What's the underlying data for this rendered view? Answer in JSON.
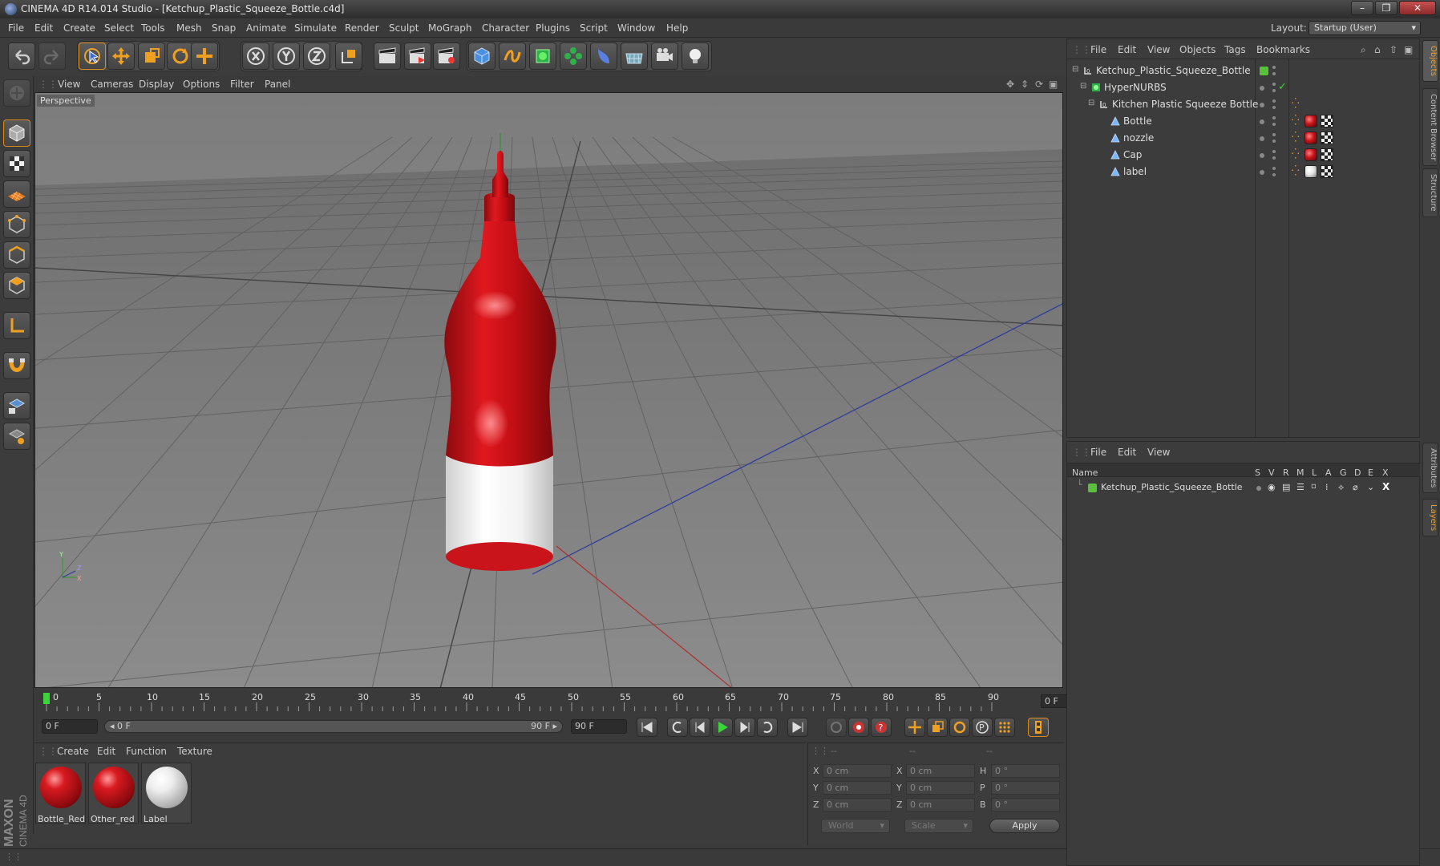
{
  "window": {
    "title": "CINEMA 4D R14.014 Studio - [Ketchup_Plastic_Squeeze_Bottle.c4d]",
    "controls": [
      "–",
      "❐",
      "✕"
    ]
  },
  "menu": [
    "File",
    "Edit",
    "Create",
    "Select",
    "Tools",
    "Mesh",
    "Snap",
    "Animate",
    "Simulate",
    "Render",
    "Sculpt",
    "MoGraph",
    "Character",
    "Plugins",
    "Script",
    "Window",
    "Help"
  ],
  "layout": {
    "label": "Layout:",
    "value": "Startup (User)"
  },
  "viewport": {
    "menu": [
      "View",
      "Cameras",
      "Display",
      "Options",
      "Filter",
      "Panel"
    ],
    "label": "Perspective"
  },
  "timeline": {
    "ticks": [
      "0",
      "5",
      "10",
      "15",
      "20",
      "25",
      "30",
      "35",
      "40",
      "45",
      "50",
      "55",
      "60",
      "65",
      "70",
      "75",
      "80",
      "85",
      "90"
    ],
    "current_frame": "0 F"
  },
  "transport": {
    "start_field": "0 F",
    "range_start": "◂ 0 F",
    "range_end": "90 F ▸",
    "end_field": "90 F"
  },
  "materials": {
    "menu": [
      "Create",
      "Edit",
      "Function",
      "Texture"
    ],
    "items": [
      {
        "name": "Bottle_Red",
        "color": "#c8141a"
      },
      {
        "name": "Other_red",
        "color": "#c8141a"
      },
      {
        "name": "Label",
        "color": "#f4f4f4"
      }
    ]
  },
  "coordinates": {
    "header": [
      "--",
      "--",
      "--"
    ],
    "rows": [
      {
        "a_lbl": "X",
        "a": "0 cm",
        "b_lbl": "X",
        "b": "0 cm",
        "c_lbl": "H",
        "c": "0 °"
      },
      {
        "a_lbl": "Y",
        "a": "0 cm",
        "b_lbl": "Y",
        "b": "0 cm",
        "c_lbl": "P",
        "c": "0 °"
      },
      {
        "a_lbl": "Z",
        "a": "0 cm",
        "b_lbl": "Z",
        "b": "0 cm",
        "c_lbl": "B",
        "c": "0 °"
      }
    ],
    "world": "World",
    "scale": "Scale",
    "apply": "Apply"
  },
  "objects": {
    "menu": [
      "File",
      "Edit",
      "View",
      "Objects",
      "Tags",
      "Bookmarks"
    ],
    "tree": [
      {
        "name": "Ketchup_Plastic_Squeeze_Bottle",
        "indent": 0,
        "icon": "null"
      },
      {
        "name": "HyperNURBS",
        "indent": 1,
        "icon": "nurbs"
      },
      {
        "name": "Kitchen Plastic Squeeze Bottle",
        "indent": 2,
        "icon": "null"
      },
      {
        "name": "Bottle",
        "indent": 3,
        "icon": "poly",
        "mat": "#c8141a"
      },
      {
        "name": "nozzle",
        "indent": 3,
        "icon": "poly",
        "mat": "#c8141a"
      },
      {
        "name": "Cap",
        "indent": 3,
        "icon": "poly",
        "mat": "#c8141a"
      },
      {
        "name": "label",
        "indent": 3,
        "icon": "poly",
        "mat": "#f0f0f0"
      }
    ]
  },
  "layers": {
    "menu": [
      "File",
      "Edit",
      "View"
    ],
    "columns": [
      "Name",
      "S",
      "V",
      "R",
      "M",
      "L",
      "A",
      "G",
      "D",
      "E",
      "X"
    ],
    "rows": [
      {
        "name": "Ketchup_Plastic_Squeeze_Bottle",
        "color": "#58c03a"
      }
    ]
  },
  "right_tabs": [
    "Objects",
    "Content Browser",
    "Structure",
    "Attributes",
    "Layers"
  ],
  "brand": {
    "maxon": "MAXON",
    "c4d": "CINEMA 4D"
  }
}
